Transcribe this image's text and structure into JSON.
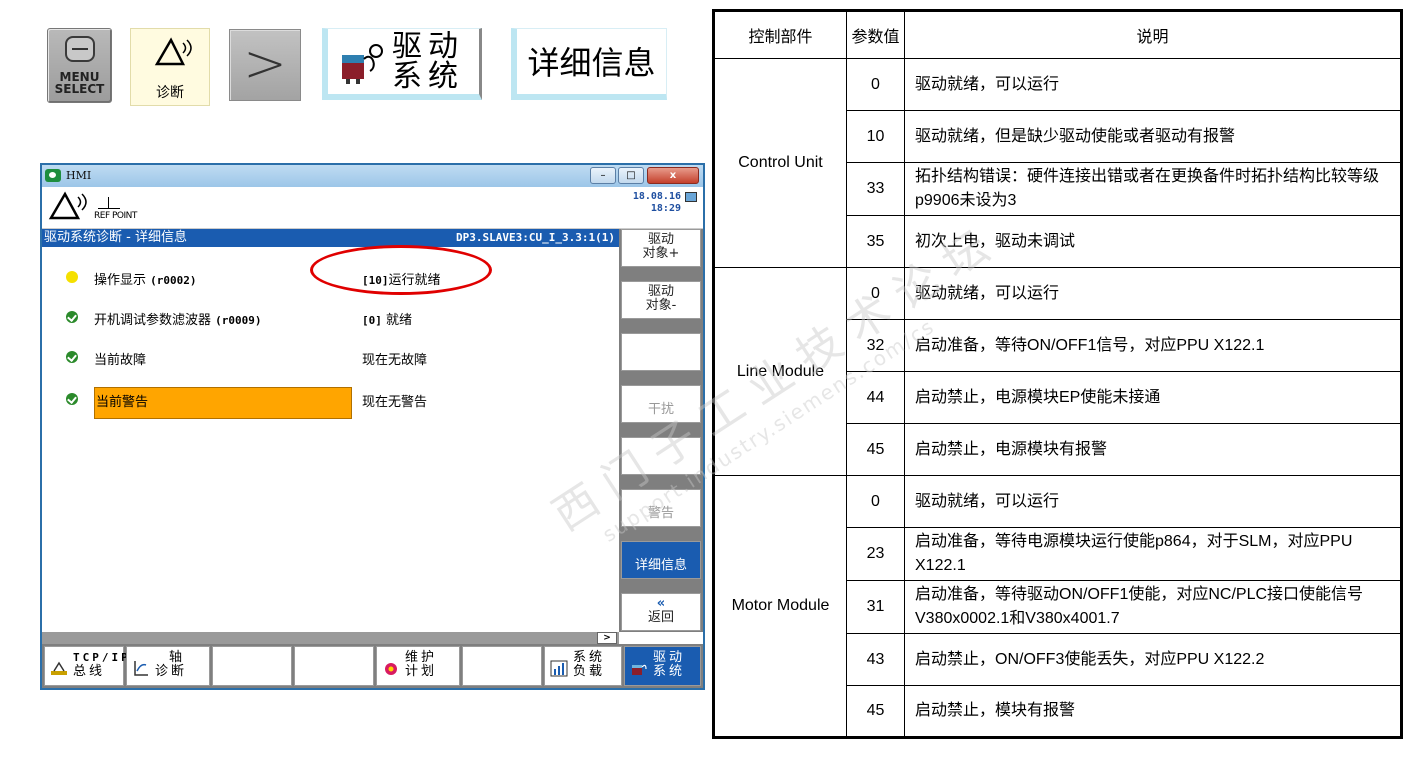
{
  "softkeys": {
    "menu_select": "MENU\nSELECT",
    "menu_select_l1": "MENU",
    "menu_select_l2": "SELECT",
    "diagnosis": "诊断",
    "next": ">",
    "drive_system_l1": "驱动",
    "drive_system_l2": "系统",
    "detail_info": "详细信息"
  },
  "hmi": {
    "window_title": "HMI",
    "date": "18.08.16",
    "time": "18:29",
    "ref_point": "REF POINT",
    "panel_title": "驱动系统诊断 - 详细信息",
    "panel_object": "DP3.SLAVE3:CU_I_3.3:1(1)",
    "rows": [
      {
        "status": "yellow",
        "name": "操作显示 ",
        "code": "(r0002)",
        "val_code": "[10]",
        "val": "运行就绪"
      },
      {
        "status": "ok",
        "name": "开机调试参数滤波器 ",
        "code": "(r0009)",
        "val_code": "[0]",
        "val": " 就绪"
      },
      {
        "status": "ok",
        "name": "当前故障",
        "code": "",
        "val_code": "",
        "val": "现在无故障"
      },
      {
        "status": "ok",
        "name": "当前警告",
        "code": "",
        "val_code": "",
        "val": "现在无警告"
      }
    ],
    "side_keys": [
      {
        "l1": "驱动",
        "l2": "对象+"
      },
      {
        "l1": "驱动",
        "l2": "对象-"
      },
      {
        "l1": "",
        "l2": ""
      },
      {
        "l1": "",
        "l2": "干扰"
      },
      {
        "l1": "",
        "l2": ""
      },
      {
        "l1": "",
        "l2": "警告"
      },
      {
        "l1": "",
        "l2": "详细信息"
      },
      {
        "l1": "«",
        "l2": "返回"
      }
    ],
    "scroll_arrow": ">",
    "bottom_keys": [
      {
        "l1": "TCP/IP",
        "l2": "总线"
      },
      {
        "l1": "轴",
        "l2": "诊断"
      },
      {
        "l1": "",
        "l2": ""
      },
      {
        "l1": "",
        "l2": ""
      },
      {
        "l1": "维护",
        "l2": "计划"
      },
      {
        "l1": "",
        "l2": ""
      },
      {
        "l1": "系统",
        "l2": "负载"
      },
      {
        "l1": "驱动",
        "l2": "系统"
      }
    ]
  },
  "table": {
    "headers": [
      "控制部件",
      "参数值",
      "说明"
    ],
    "groups": [
      {
        "component": "Control Unit",
        "rows": [
          {
            "value": "0",
            "desc": "驱动就绪，可以运行"
          },
          {
            "value": "10",
            "desc": "驱动就绪，但是缺少驱动使能或者驱动有报警"
          },
          {
            "value": "33",
            "desc": "拓扑结构错误：硬件连接出错或者在更换备件时拓扑结构比较等级p9906未设为3"
          },
          {
            "value": "35",
            "desc": "初次上电，驱动未调试"
          }
        ]
      },
      {
        "component": "Line Module",
        "rows": [
          {
            "value": "0",
            "desc": "驱动就绪，可以运行"
          },
          {
            "value": "32",
            "desc": "启动准备，等待ON/OFF1信号，对应PPU X122.1"
          },
          {
            "value": "44",
            "desc": "启动禁止，电源模块EP使能未接通"
          },
          {
            "value": "45",
            "desc": "启动禁止，电源模块有报警"
          }
        ]
      },
      {
        "component": "Motor Module",
        "rows": [
          {
            "value": "0",
            "desc": "驱动就绪，可以运行"
          },
          {
            "value": "23",
            "desc": "启动准备，等待电源模块运行使能p864，对于SLM，对应PPU X122.1"
          },
          {
            "value": "31",
            "desc": "启动准备，等待驱动ON/OFF1使能，对应NC/PLC接口使能信号V380x0002.1和V380x4001.7"
          },
          {
            "value": "43",
            "desc": "启动禁止，ON/OFF3使能丢失，对应PPU X122.2"
          },
          {
            "value": "45",
            "desc": "启动禁止，模块有报警"
          }
        ]
      }
    ]
  },
  "watermark": {
    "line1": "西门子工业技术论坛",
    "line2": "support.industry.siemens.com/cs"
  },
  "colors": {
    "accent_blue": "#1a5cb0",
    "highlight_orange": "#ffa500",
    "oval_red": "#e00000",
    "ok_green": "#2b8a2b",
    "status_yellow": "#f5e000"
  }
}
